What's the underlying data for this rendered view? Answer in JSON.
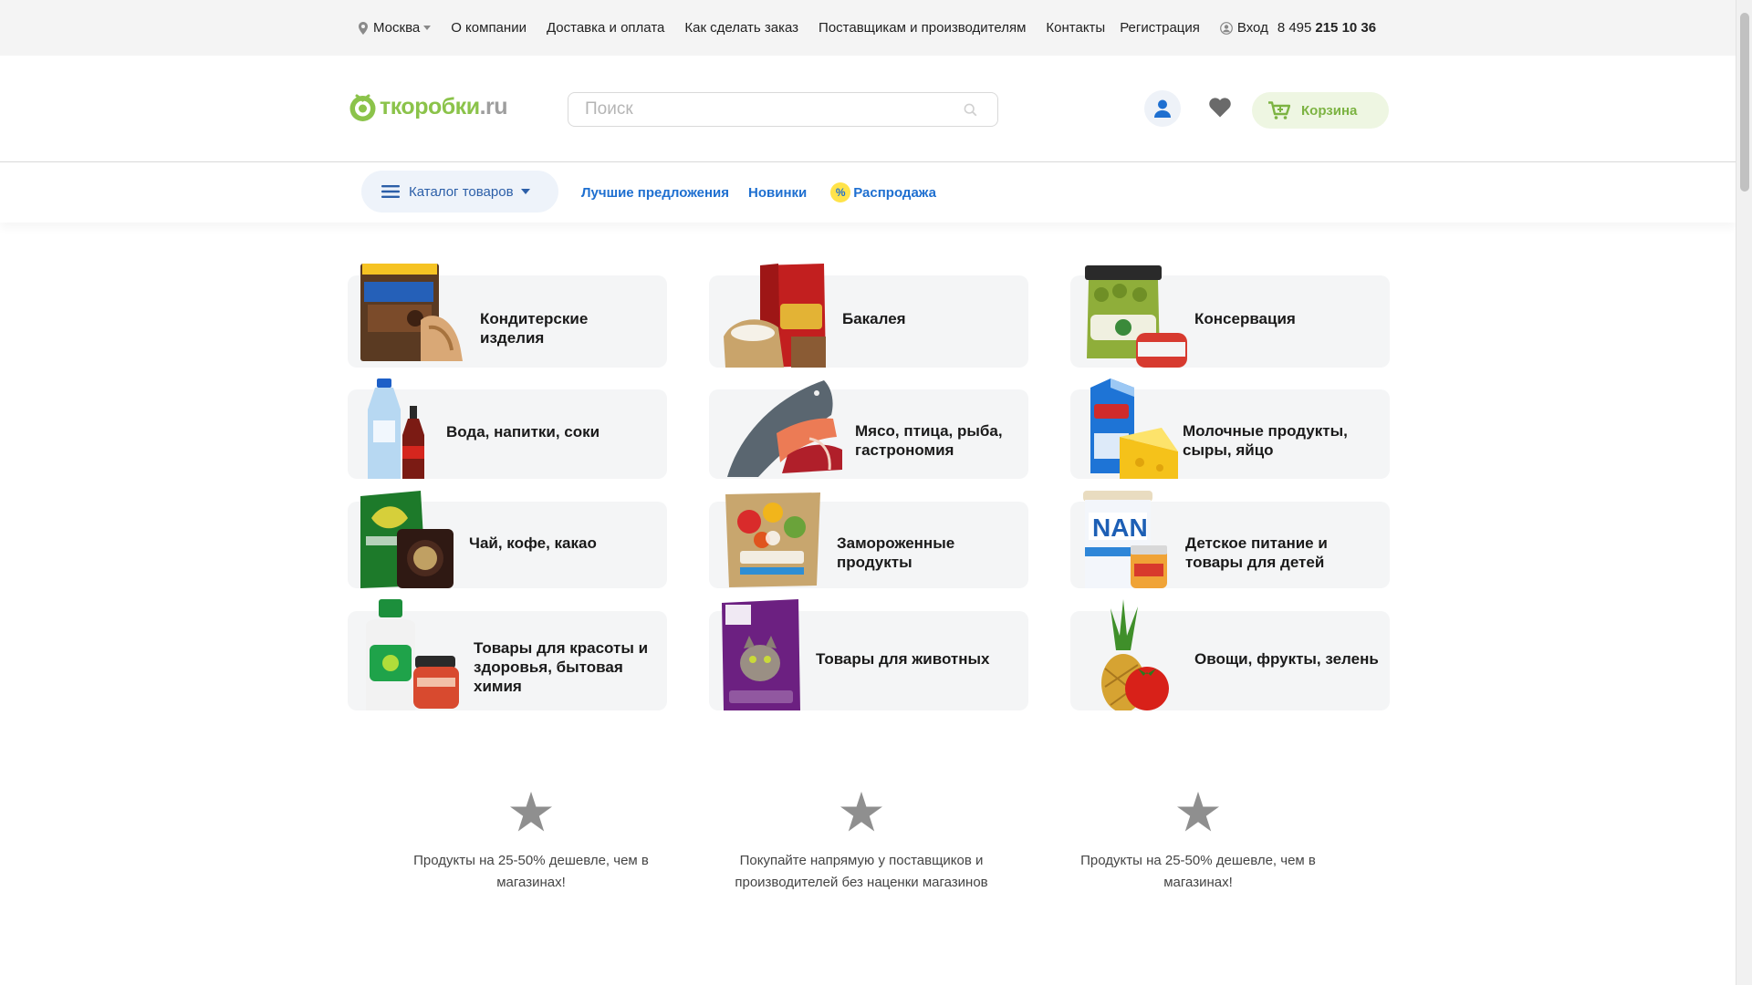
{
  "topbar": {
    "city": "Москва",
    "links": [
      "О компании",
      "Доставка и оплата",
      "Как сделать заказ",
      "Поставщикам и производителям",
      "Контакты",
      "Регистрация"
    ],
    "login": "Вход",
    "phone_prefix": "8 495",
    "phone_main": "215 10 36"
  },
  "header": {
    "logo_name": "ткоробки",
    "logo_domain": ".ru",
    "search_placeholder": "Поиск",
    "cart_label": "Корзина"
  },
  "nav": {
    "catalog_label": "Каталог товаров",
    "links": [
      "Лучшие предложения",
      "Новинки"
    ],
    "sale_badge": "%",
    "sale_label": "Распродажа"
  },
  "categories": [
    {
      "label": "Кондитерские изделия",
      "icon": "candy-icon"
    },
    {
      "label": "Бакалея",
      "icon": "flour-bag-icon"
    },
    {
      "label": "Консервация",
      "icon": "jar-can-icon"
    },
    {
      "label": "Вода, напитки, соки",
      "icon": "bottles-icon"
    },
    {
      "label": "Мясо, птица, рыба, гастрономия",
      "icon": "fish-meat-icon"
    },
    {
      "label": "Молочные продукты, сыры, яйцо",
      "icon": "milk-cheese-icon"
    },
    {
      "label": "Чай, кофе, какао",
      "icon": "tea-coffee-icon"
    },
    {
      "label": "Замороженные продукты",
      "icon": "frozen-veg-icon"
    },
    {
      "label": "Детское питание и товары для детей",
      "icon": "baby-formula-icon"
    },
    {
      "label": "Товары для красоты и здоровья, бытовая химия",
      "icon": "detergent-cosmetics-icon"
    },
    {
      "label": "Товары для животных",
      "icon": "cat-food-icon"
    },
    {
      "label": "Овощи, фрукты, зелень",
      "icon": "pineapple-tomato-icon"
    }
  ],
  "advantages": [
    {
      "text": "Продукты на 25-50% дешевле, чем в магазинах!"
    },
    {
      "text": "Покупайте напрямую у поставщиков и производителей без наценки магазинов"
    },
    {
      "text": "Продукты на 25-50% дешевле, чем в магазинах!"
    }
  ],
  "colors": {
    "brand_green": "#8bc34a",
    "link_blue": "#1e6fd0",
    "card_bg": "#f4f5f6",
    "sale_yellow": "#ffe34a"
  }
}
